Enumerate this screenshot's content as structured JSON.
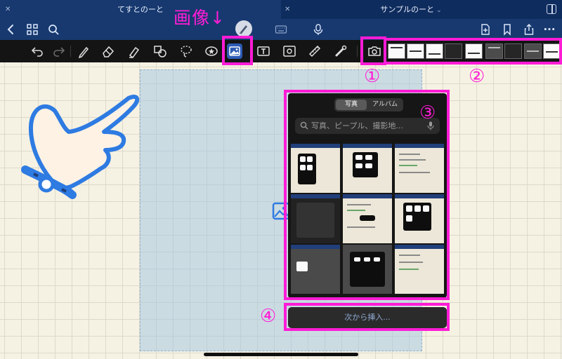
{
  "tabs": [
    {
      "title": "てすとのーと",
      "close": "✕"
    },
    {
      "title": "サンプルのーと",
      "close": "✕",
      "chevron": "⌄"
    }
  ],
  "navbar": {
    "icons": [
      "chevron-left-icon",
      "grid-icon",
      "search-icon",
      "pen-mode-icon",
      "keyboard-icon",
      "microphone-icon",
      "add-page-icon",
      "bookmark-icon",
      "share-icon",
      "more-icon"
    ],
    "more_label": "···"
  },
  "toolbar": {
    "tools": [
      "undo-icon",
      "redo-icon",
      "pen-icon",
      "eraser-icon",
      "highlighter-icon",
      "shapes-icon",
      "lasso-icon",
      "sticker-icon",
      "image-icon",
      "textbox-icon",
      "image-capture-icon",
      "ruler-icon",
      "laser-pointer-icon",
      "camera-icon"
    ],
    "active_tool": "image-icon",
    "recent_images_count": 9
  },
  "photo_picker": {
    "segments": [
      "写真",
      "アルバム"
    ],
    "selected_segment": "写真",
    "search_placeholder": "写真、ピープル、撮影地...",
    "thumbnail_count": 9
  },
  "insert_button": {
    "label": "次から挿入..."
  },
  "annotations": {
    "image_label": "画像↓",
    "marker_1": "①",
    "marker_2": "②",
    "marker_3": "③",
    "marker_4": "④",
    "color": "#ff1cd6"
  },
  "colors": {
    "tabbar": "#0f2c5e",
    "navbar": "#17396f",
    "toolbar": "#141414",
    "paper": "#f6f2e3",
    "accent": "#2d5bb5"
  }
}
